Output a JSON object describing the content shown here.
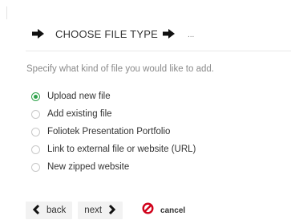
{
  "header": {
    "title": "CHOOSE FILE TYPE",
    "ellipsis": "...",
    "arrow_icon": "arrow-right-icon",
    "arrow_color": "#111111"
  },
  "instructions": "Specify what kind of file you would like to add.",
  "options": {
    "selected_index": 0,
    "items": [
      {
        "label": "Upload new file",
        "checked": true
      },
      {
        "label": "Add existing file",
        "checked": false
      },
      {
        "label": "Foliotek Presentation Portfolio",
        "checked": false
      },
      {
        "label": "Link to external file or website (URL)",
        "checked": false
      },
      {
        "label": "New zipped website",
        "checked": false
      }
    ],
    "checked_color": "#2ea34a"
  },
  "nav": {
    "back_label": "back",
    "back_icon": "chevron-left-icon",
    "next_label": "next",
    "next_icon": "chevron-right-icon",
    "cancel_label": "cancel",
    "cancel_icon": "no-entry-icon",
    "cancel_color": "#d0021b"
  }
}
